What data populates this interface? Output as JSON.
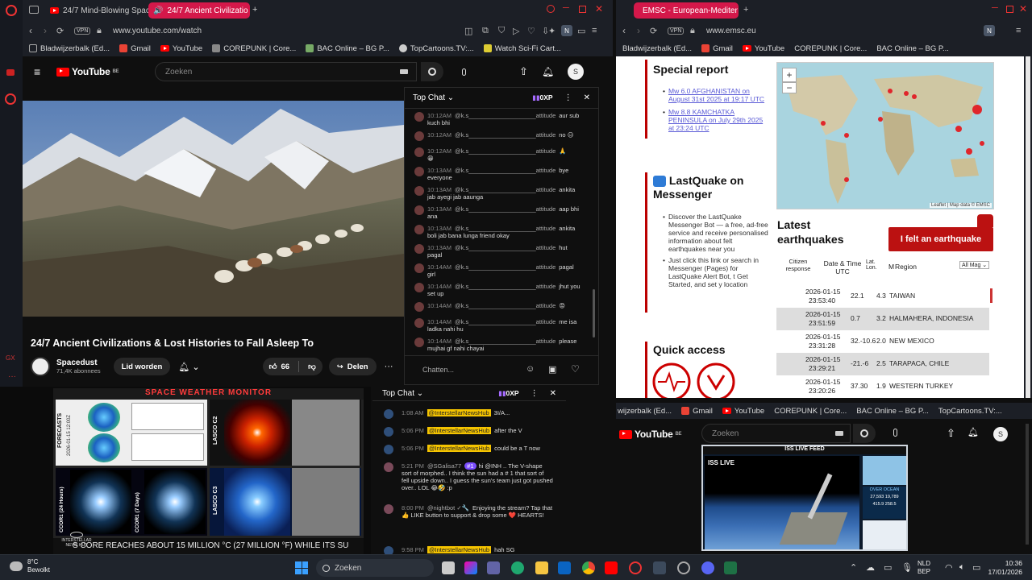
{
  "left_browser": {
    "tabs": [
      {
        "label": "24/7 Mind-Blowing Space"
      },
      {
        "label": "24/7 Ancient Civilizatio",
        "active": true
      }
    ],
    "vpn": "VPN",
    "url": "www.youtube.com/watch",
    "bookmarks": [
      "Bladwijzerbalk (Ed...",
      "Gmail",
      "YouTube",
      "COREPUNK | Core...",
      "BAC Online – BG P...",
      "TopCartoons.TV:...",
      "Watch Sci-Fi Cart..."
    ],
    "youtube": {
      "logo": "YouTube",
      "region": "BE",
      "search_placeholder": "Zoeken",
      "profile_initial": "S",
      "video_title": "24/7 Ancient Civilizations & Lost Histories to Fall Asleep To",
      "channel_name": "Spacedust",
      "subscribers": "71,4K abonnees",
      "join_label": "Lid worden",
      "likes": "66",
      "share_label": "Delen"
    },
    "chat": {
      "mode": "Top Chat",
      "points": "0XP",
      "input_placeholder": "Chatten...",
      "messages": [
        {
          "time": "10:12AM",
          "user": "@k.s____________________attitude",
          "text": "aur sub",
          "cont": "kuch bhi"
        },
        {
          "time": "10:12AM",
          "user": "@k.s____________________attitude",
          "text": "no 😑"
        },
        {
          "time": "10:12AM",
          "user": "@k.s____________________attitude",
          "text": "🙏",
          "cont": "😁"
        },
        {
          "time": "10:13AM",
          "user": "@k.s____________________attitude",
          "text": "bye",
          "cont": "everyone"
        },
        {
          "time": "10:13AM",
          "user": "@k.s____________________attitude",
          "text": "ankita",
          "cont": "jab ayegi jab aaunga"
        },
        {
          "time": "10:13AM",
          "user": "@k.s____________________attitude",
          "text": "aap bhi",
          "cont": "ana"
        },
        {
          "time": "10:13AM",
          "user": "@k.s____________________attitude",
          "text": "ankita",
          "cont": "boli jab bana lunga friend okay"
        },
        {
          "time": "10:13AM",
          "user": "@k.s____________________attitude",
          "text": "hut",
          "cont": "pagal"
        },
        {
          "time": "10:14AM",
          "user": "@k.s____________________attitude",
          "text": "pagal",
          "cont": "girl"
        },
        {
          "time": "10:14AM",
          "user": "@k.s____________________attitude",
          "text": "jhut you",
          "cont": "set up"
        },
        {
          "time": "10:14AM",
          "user": "@k.s____________________attitude",
          "text": "😡"
        },
        {
          "time": "10:14AM",
          "user": "@k.s____________________attitude",
          "text": "me isa",
          "cont": "ladka nahi hu"
        },
        {
          "time": "10:14AM",
          "user": "@k.s____________________attitude",
          "text": "please",
          "cont": "mujhai gf nahi chayai"
        }
      ]
    }
  },
  "right_browser": {
    "tab_label": "EMSC - European-Mediter",
    "url": "www.emsc.eu",
    "bookmarks": [
      "Bladwijzerbalk (Ed...",
      "Gmail",
      "YouTube",
      "COREPUNK | Core...",
      "BAC Online – BG P..."
    ],
    "special_report_title": "Special report",
    "reports": [
      "Mw 6.0 AFGHANISTAN on August 31st 2025 at 19:17 UTC",
      "Mw 8.8 KAMCHATKA PENINSULA on July 29th 2025 at 23:24 UTC"
    ],
    "lastquake_title": "LastQuake on Messenger",
    "lastquake_bullets": [
      "Discover the LastQuake Messenger Bot — a free, ad-free service and receive personalised information about felt earthquakes near you",
      "Just click this link or search in Messenger (Pages) for LastQuake Alert Bot, t Get Started, and set y location"
    ],
    "quick_access_title": "Quick access",
    "map_attribution": "Leaflet | Map data © EMSC",
    "latest_title": "Latest earthquakes",
    "felt_button": "I felt an earthquake",
    "columns": [
      "Citizen response",
      "Date & Time UTC",
      "Lat. Lon.",
      "M",
      "Region"
    ],
    "mag_filter": "All Mag",
    "quakes": [
      {
        "date": "2026-01-15",
        "time": "23:53:40",
        "lat": "22.1",
        "lon": "",
        "mag": "4.3",
        "region": "TAIWAN"
      },
      {
        "date": "2026-01-15",
        "time": "23:51:59",
        "lat": "0.7",
        "lon": "",
        "mag": "3.2",
        "region": "HALMAHERA, INDONESIA"
      },
      {
        "date": "2026-01-15",
        "time": "23:31:28",
        "lat": "32.-10.6",
        "lon": "",
        "mag": "2.0",
        "region": "NEW MEXICO"
      },
      {
        "date": "2026-01-15",
        "time": "23:29:21",
        "lat": "-21.-6",
        "lon": "",
        "mag": "2.5",
        "region": "TARAPACA, CHILE"
      },
      {
        "date": "2026-01-15",
        "time": "23:20:26",
        "lat": "37.30",
        "lon": "",
        "mag": "1.9",
        "region": "WESTERN TURKEY"
      }
    ]
  },
  "space_weather": {
    "title": "SPACE WEATHER MONITOR",
    "title_highlight": "SPACE",
    "panels": [
      "FORECASTS",
      "LASCO C2",
      "CCOR1 (24 Hours)",
      "CCOR1 (7 Days)",
      "LASCO C3"
    ],
    "date_label": "2026-01-15 12:00Z",
    "ticker": "S CORE REACHES ABOUT 15 MILLION °C (27 MILLION °F) WHILE ITS SU",
    "brand": "INTERSTELLAR NEWS HUB"
  },
  "chat2": {
    "mode": "Top Chat",
    "points": "0XP",
    "messages": [
      {
        "time": "1:08 AM",
        "user": "@InterstellarNewsHub",
        "text": "3I/A..."
      },
      {
        "time": "5:06 PM",
        "user": "@InterstellarNewsHub",
        "text": "after the V"
      },
      {
        "time": "5:06 PM",
        "user": "@InterstellarNewsHub",
        "text": "could be a T now"
      },
      {
        "time": "5:21 PM",
        "user": "@SGalisa77",
        "badge": "#1",
        "text": "hi @INH .. The V-shape sort of morphed.. I think the sun had a # 1 that sort of fell upside down.. I guess the sun's team just got pushed over.. LOL 😂🤣 :p"
      },
      {
        "time": "8:00 PM",
        "user": "@nightbot ✓🔧",
        "text": "Enjoying the stream? Tap that 👍 LIKE button to support & drop some ❤️ HEARTS!"
      },
      {
        "time": "9:58 PM",
        "user": "@InterstellarNewsHub",
        "text": "hah SG"
      }
    ]
  },
  "youtube2": {
    "bookmarks": [
      "wijzerbalk (Ed...",
      "Gmail",
      "YouTube",
      "COREPUNK | Core...",
      "BAC Online – BG P...",
      "TopCartoons.TV:..."
    ],
    "logo": "YouTube",
    "region": "BE",
    "search_placeholder": "Zoeken",
    "profile_initial": "S",
    "iss_header": "ISS LIVE FEED",
    "iss_live": "LIVE",
    "iss_label": "ISS LIVE",
    "iss_over": "OVER OCEAN",
    "iss_stats": [
      "27,593",
      "19,789",
      "415.9",
      "258.5"
    ]
  },
  "taskbar": {
    "weather_temp": "8°C",
    "weather_desc": "Bewolkt",
    "search_placeholder": "Zoeken",
    "lang": "NLD",
    "lang2": "BEP",
    "time": "10:36",
    "date": "17/01/2026"
  }
}
